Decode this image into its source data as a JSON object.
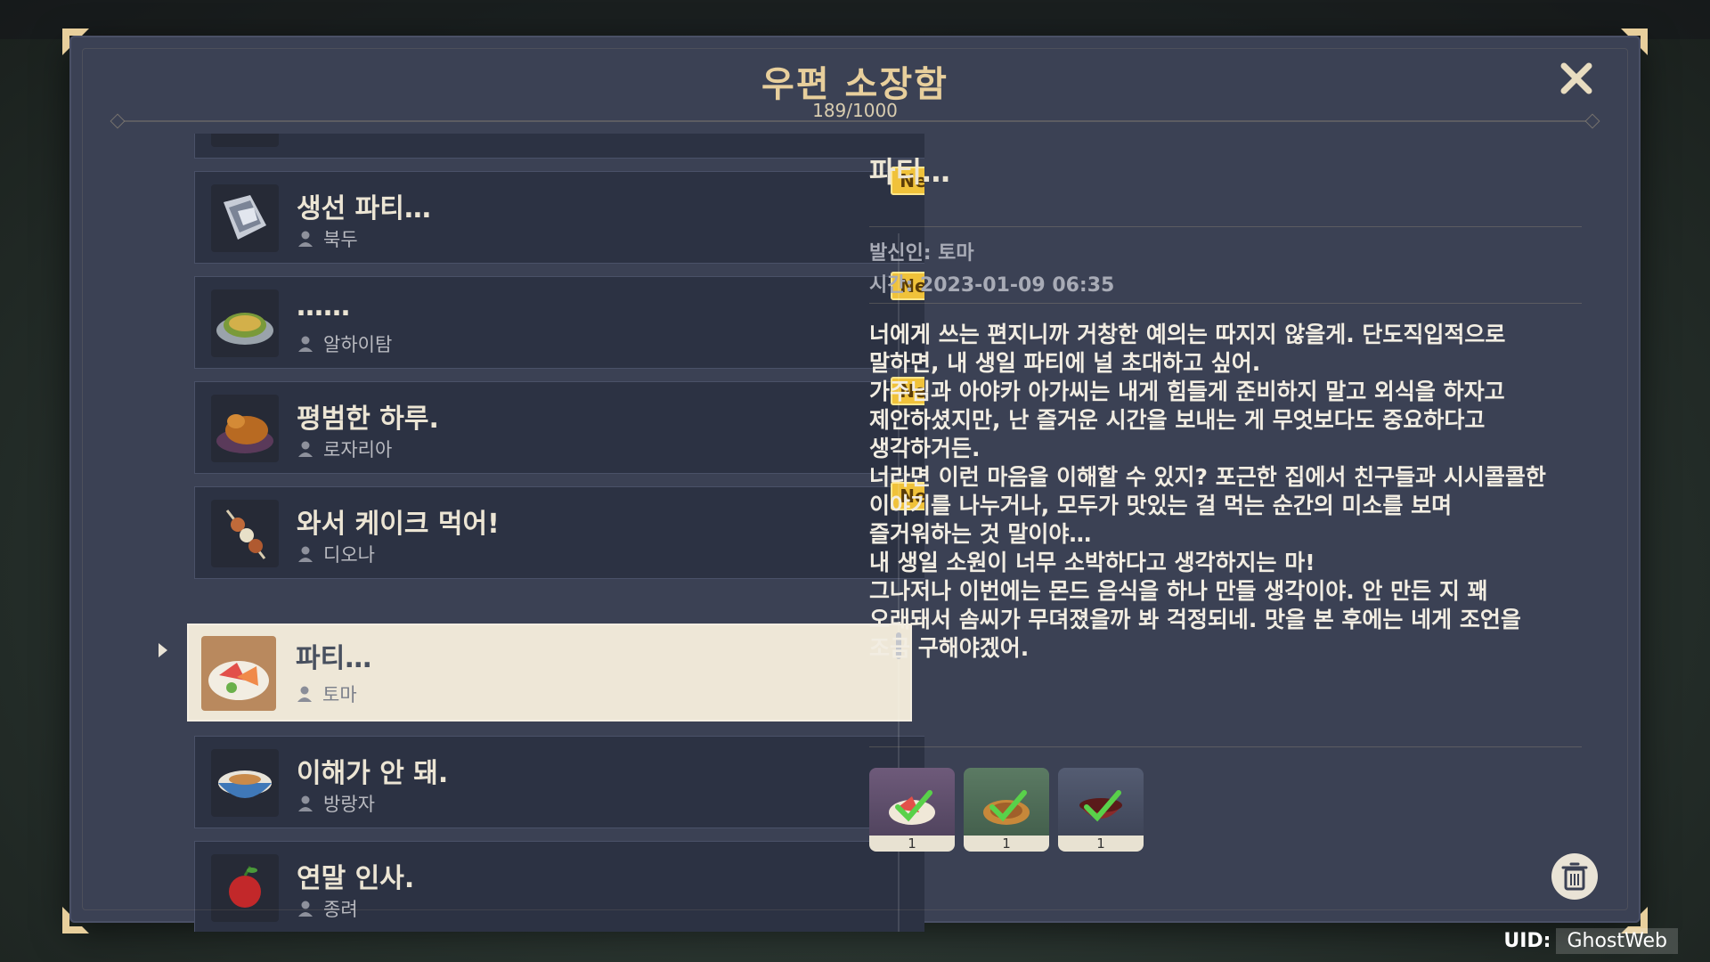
{
  "dialog": {
    "title": "우편 소장함",
    "count": "189/1000"
  },
  "list": {
    "partial_item": {
      "title": "",
      "sender": ""
    },
    "items": [
      {
        "title": "생선 파티…",
        "sender": "북두",
        "badge": "New",
        "icon": "fish-dish-icon"
      },
      {
        "title": "……",
        "sender": "알하이탐",
        "badge": "New",
        "icon": "omelette-dish-icon"
      },
      {
        "title": "평범한 하루.",
        "sender": "로자리아",
        "badge": "New",
        "icon": "roast-chicken-icon"
      },
      {
        "title": "와서 케이크 먹어!",
        "sender": "디오나",
        "badge": "New",
        "icon": "skewer-icon"
      },
      {
        "title": "파티…",
        "sender": "토마",
        "selected": true,
        "icon": "sashimi-platter-icon"
      },
      {
        "title": "이해가 안 돼.",
        "sender": "방랑자",
        "icon": "rice-bowl-icon"
      },
      {
        "title": "연말 인사.",
        "sender": "종려",
        "icon": "red-fruit-icon"
      }
    ]
  },
  "detail": {
    "title": "파티…",
    "sender": "발신인: 토마",
    "time": "시간: 2023-01-09 06:35",
    "body": "너에게 쓰는 편지니까 거창한 예의는 따지지 않을게. 단도직입적으로\n말하면, 내 생일 파티에 널 초대하고 싶어.\n가주님과 아야카 아가씨는 내게 힘들게 준비하지 말고 외식을 하자고\n제안하셨지만, 난 즐거운 시간을 보내는 게 무엇보다도 중요하다고\n생각하거든.\n너라면 이런 마음을 이해할 수 있지? 포근한 집에서 친구들과 시시콜콜한\n이야기를 나누거나, 모두가 맛있는 걸 먹는 순간의 미소를 보며\n즐거워하는 것 말이야…\n내 생일 소원이 너무 소박하다고 생각하지는 마!\n그나저나 이번에는 몬드 음식을 하나 만들 생각이야. 안 만든 지 꽤\n오래돼서 솜씨가 무뎌졌을까 봐 걱정되네. 맛을 본 후에는 네게 조언을\n조금 구해야겠어.",
    "attachments": [
      {
        "qty": "1",
        "icon": "sashimi-attachment-icon",
        "claimed": true
      },
      {
        "qty": "1",
        "icon": "plate-attachment-icon",
        "claimed": true
      },
      {
        "qty": "1",
        "icon": "bowl-attachment-icon",
        "claimed": true
      }
    ]
  },
  "uid": {
    "label": "UID:",
    "value": "GhostWeb"
  },
  "colors": {
    "accent": "#e8cf9c",
    "panel": "#3b4154",
    "new_badge": "#f0c23a",
    "selected": "#eee7d7"
  }
}
